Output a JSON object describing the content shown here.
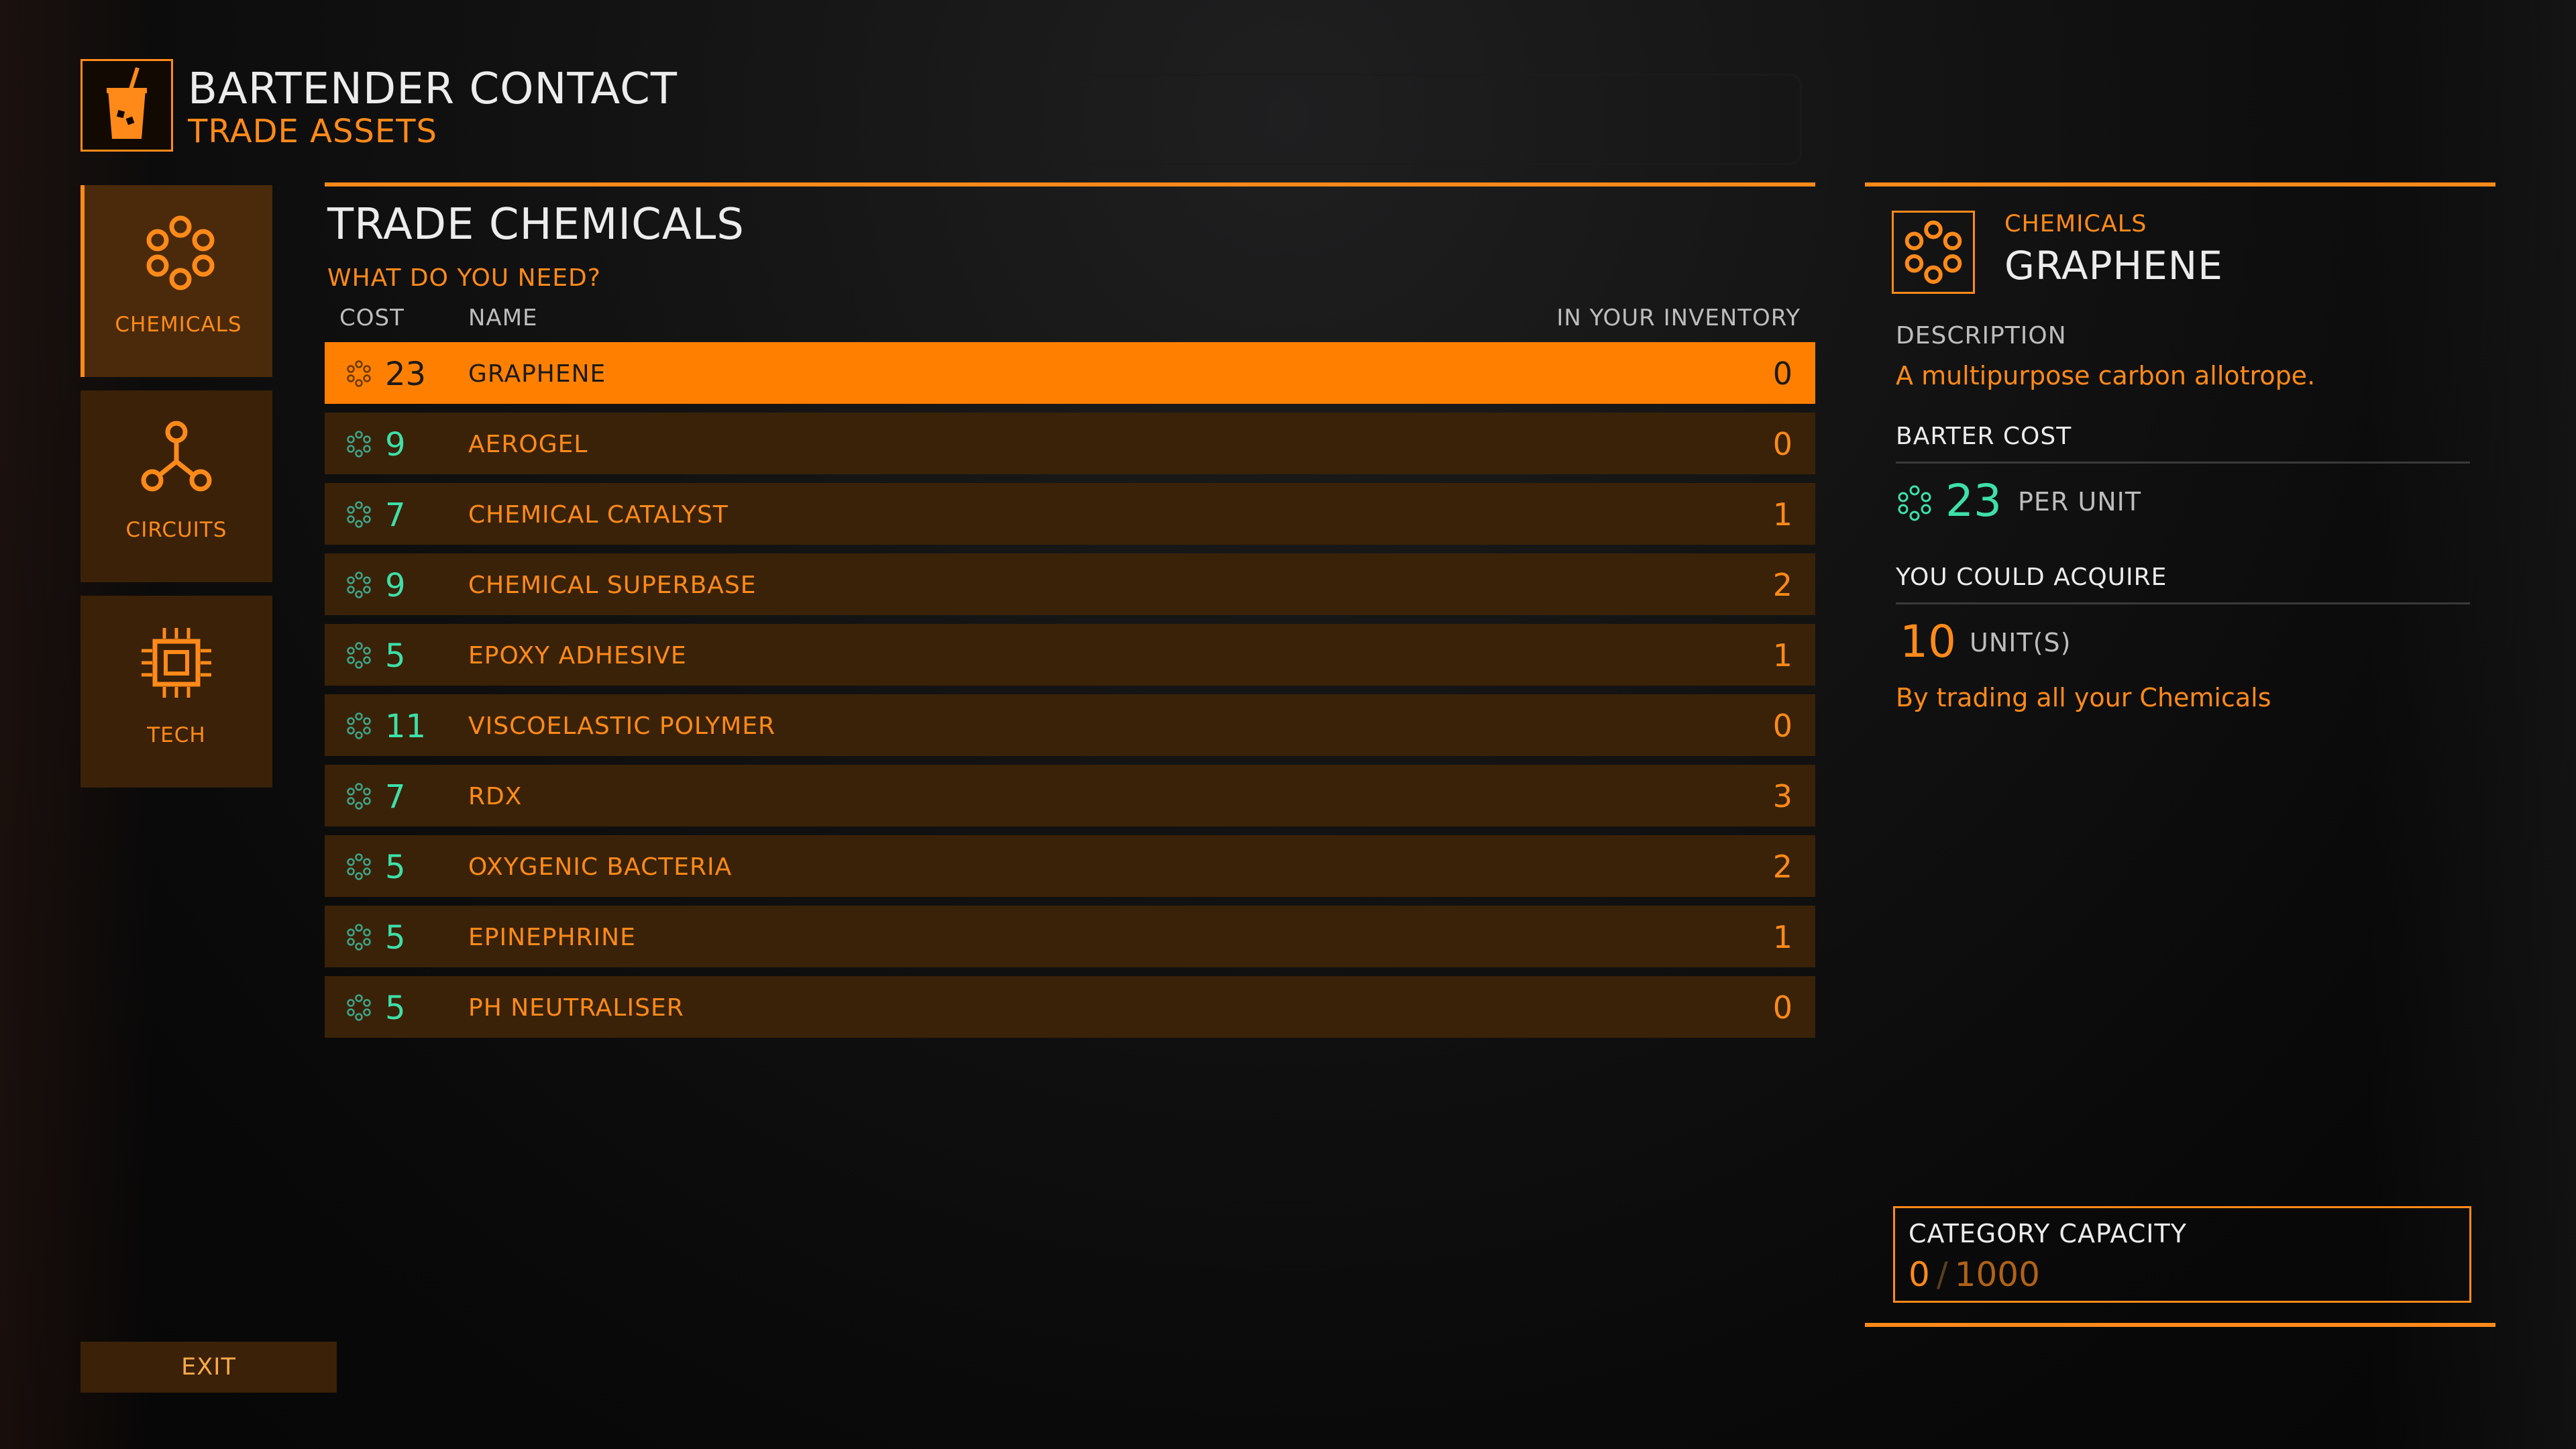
{
  "header": {
    "title": "BARTENDER CONTACT",
    "subtitle": "TRADE ASSETS",
    "icon": "drink-icon"
  },
  "categories": [
    {
      "label": "CHEMICALS",
      "icon": "chemicals-icon",
      "active": true
    },
    {
      "label": "CIRCUITS",
      "icon": "circuits-icon",
      "active": false
    },
    {
      "label": "TECH",
      "icon": "tech-icon",
      "active": false
    }
  ],
  "list": {
    "title": "TRADE CHEMICALS",
    "subtitle": "WHAT DO YOU NEED?",
    "columns": {
      "cost": "COST",
      "name": "NAME",
      "inventory": "IN YOUR INVENTORY"
    },
    "rows": [
      {
        "cost": "23",
        "name": "GRAPHENE",
        "inventory": "0"
      },
      {
        "cost": "9",
        "name": "AEROGEL",
        "inventory": "0"
      },
      {
        "cost": "7",
        "name": "CHEMICAL CATALYST",
        "inventory": "1"
      },
      {
        "cost": "9",
        "name": "CHEMICAL SUPERBASE",
        "inventory": "2"
      },
      {
        "cost": "5",
        "name": "EPOXY ADHESIVE",
        "inventory": "1"
      },
      {
        "cost": "11",
        "name": "VISCOELASTIC POLYMER",
        "inventory": "0"
      },
      {
        "cost": "7",
        "name": "RDX",
        "inventory": "3"
      },
      {
        "cost": "5",
        "name": "OXYGENIC BACTERIA",
        "inventory": "2"
      },
      {
        "cost": "5",
        "name": "EPINEPHRINE",
        "inventory": "1"
      },
      {
        "cost": "5",
        "name": "PH NEUTRALISER",
        "inventory": "0"
      }
    ]
  },
  "detail": {
    "category": "CHEMICALS",
    "name": "GRAPHENE",
    "description_label": "DESCRIPTION",
    "description": "A multipurpose carbon allotrope.",
    "barter_cost_label": "BARTER COST",
    "barter_cost": "23",
    "barter_unit": "PER UNIT",
    "acquire_label": "YOU COULD ACQUIRE",
    "acquire_value": "10",
    "acquire_unit": "UNIT(S)",
    "acquire_note": "By trading all your Chemicals",
    "capacity_label": "CATEGORY CAPACITY",
    "capacity_current": "0",
    "capacity_sep": "/",
    "capacity_max": "1000"
  },
  "exit_label": "EXIT",
  "colors": {
    "accent": "#ff8a1a",
    "cost": "#3ee0a8",
    "row_bg": "#3a2208",
    "selected_row": "#ff8000"
  }
}
